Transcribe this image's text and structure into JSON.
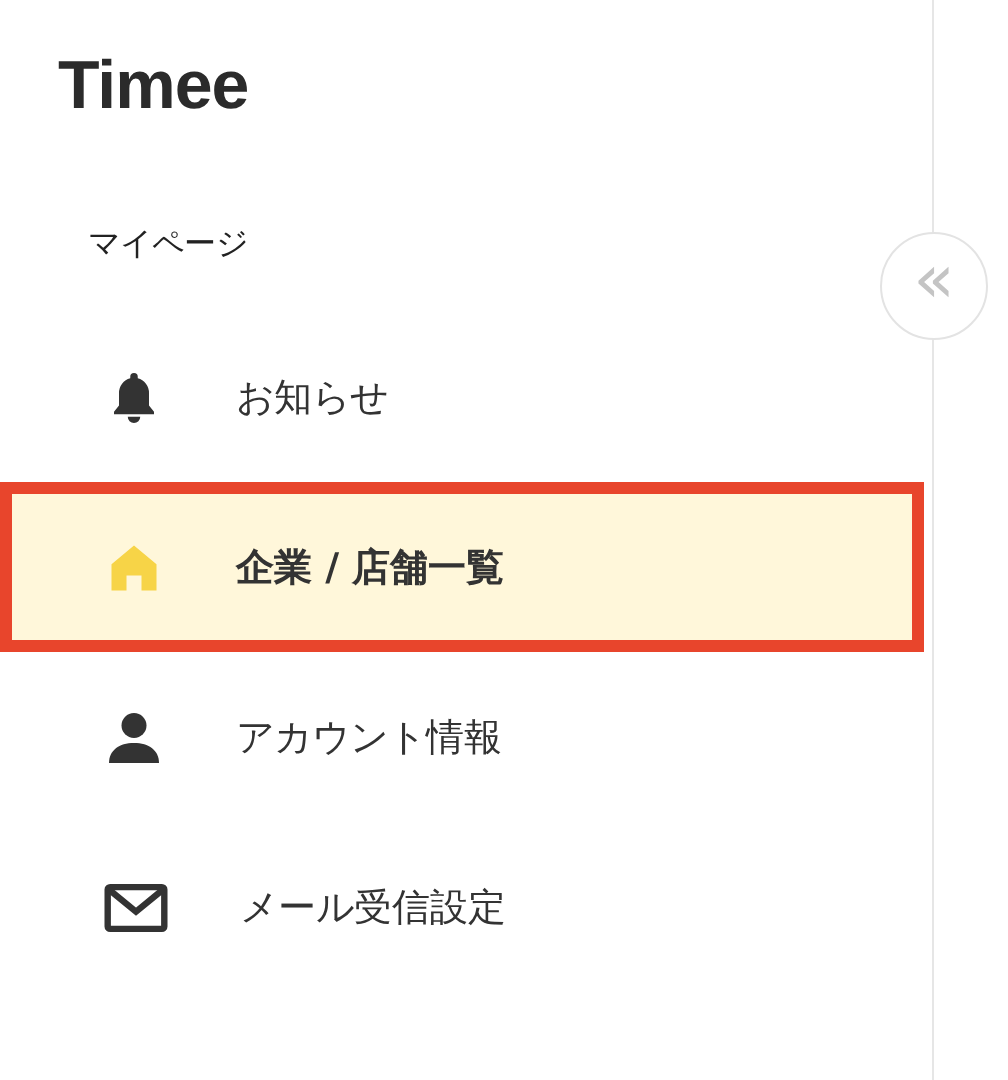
{
  "logo": "Timee",
  "section_title": "マイページ",
  "collapse_button": {
    "label": "«"
  },
  "menu": [
    {
      "label": "お知らせ",
      "selected": false
    },
    {
      "label": "企業 / 店舗一覧",
      "selected": true
    },
    {
      "label": "アカウント情報",
      "selected": false
    },
    {
      "label": "メール受信設定",
      "selected": false
    }
  ]
}
